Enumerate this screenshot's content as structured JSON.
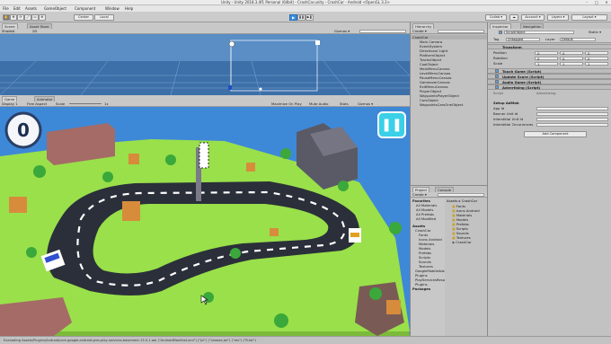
{
  "window": {
    "title": "Unity - Unity 2018.3.4f1 Personal (64bit) - CrashCar.unity - CrashCar - Android <OpenGL 3.3>",
    "minimize": "–",
    "maximize": "□",
    "close": "✕"
  },
  "menu": [
    "File",
    "Edit",
    "Assets",
    "GameObject",
    "Component",
    "Window",
    "Help"
  ],
  "toolbar": {
    "tools": [
      "✋",
      "✥",
      "⟳",
      "⤢",
      "▭",
      "⊕"
    ],
    "pivot": "Center",
    "space": "Local",
    "play": "▶",
    "pause": "❚❚",
    "step": "▶❚",
    "collab": "Collab ▾",
    "cloud": "☁",
    "account": "Account ▾",
    "layers": "Layers ▾",
    "layout": "Layout ▾"
  },
  "scene": {
    "tab_scene": "Scene",
    "tab_assetstore": "Asset Store",
    "shaded": "Shaded",
    "mode2d": "2D",
    "gizmos": "Gizmos ▾",
    "search": "All"
  },
  "game": {
    "tab_game": "Game",
    "tab_animator": "Animator",
    "display": "Display 1",
    "aspect": "Free Aspect",
    "scale_label": "Scale",
    "scale_value": "1x",
    "maximize": "Maximize On Play",
    "mute": "Mute Audio",
    "stats": "Stats",
    "gizmos": "Gizmos ▾",
    "score": "0",
    "pause_icon": "❚❚"
  },
  "hierarchy": {
    "tab": "Hierarchy",
    "create": "Create ▾",
    "search": "All",
    "root": "CrashCar",
    "items": [
      "Main Camera",
      "EventSystem",
      "Directional Light",
      "PlatformObject",
      "TracksObject",
      "CoolObject",
      "MainMenuCanvas",
      "LevelMenuCanvas",
      "PauseMenuCanvas",
      "GameoverCanvas",
      "ExitMenuCanvas",
      "PlayerObject",
      "WaypointsPlayerObject",
      "CarsObject",
      "WaypointsCarsOneObject"
    ]
  },
  "inspector": {
    "tab_inspector": "Inspector",
    "tab_navigation": "Navigation",
    "object_name": "ScriptObject",
    "static_label": "Static ▾",
    "tag_label": "Tag",
    "tag_value": "Untagged",
    "layer_label": "Layer",
    "layer_value": "Default",
    "transform": {
      "title": "Transform",
      "rows": [
        {
          "label": "Position",
          "x": "0",
          "y": "0",
          "z": "0"
        },
        {
          "label": "Rotation",
          "x": "0",
          "y": "0",
          "z": "0"
        },
        {
          "label": "Scale",
          "x": "1",
          "y": "1",
          "z": "1"
        }
      ]
    },
    "components": [
      "Touch Game (Script)",
      "Update Score (Script)",
      "Audio Game (Script)",
      "Advertising (Script)"
    ],
    "script_label": "Script",
    "script_value": "Advertising",
    "admob_header": "Setup AdMob",
    "fields": [
      "App Id",
      "Banner Unit Id",
      "Interstitial Unit Id",
      "Interstitial Occurrences"
    ],
    "add_component": "Add Component"
  },
  "project": {
    "tab_project": "Project",
    "tab_console": "Console",
    "create": "Create ▾",
    "search": "",
    "crumb_assets": "Assets",
    "crumb_sep": "▸",
    "crumb_folder": "CrashCar",
    "favorites": "Favorites",
    "fav_items": [
      "All Materials",
      "All Models",
      "All Prefabs",
      "All Modified"
    ],
    "assets_root": "Assets",
    "tree_items": [
      "CrashCar",
      "Fonts",
      "Icons Android",
      "Materials",
      "Models",
      "Prefabs",
      "Scripts",
      "Sounds",
      "Textures",
      "GoogleMobileAds",
      "Plugins",
      "PlayServicesResolver",
      "Plugins",
      "Packages"
    ],
    "grid_items": [
      "Fonts",
      "Icons Android",
      "Materials",
      "Models",
      "Prefabs",
      "Scripts",
      "Sounds",
      "Textures",
      "CrashCar"
    ]
  },
  "statusbar": {
    "text": "Evaluating Assets/Plugins/Android/com.google.android.gms.play-services-basement-15.0.1.aar (\"AndroidManifest.xml\") (\"jni\") (\"classes.jar\") (\"res\") (\"R.txt\")"
  },
  "colors": {
    "unity_bg": "#c2c2c2",
    "sky": "#3e88d8",
    "grass": "#99e04a",
    "road": "#2b2f3a",
    "accent": "#3a8ce0"
  }
}
